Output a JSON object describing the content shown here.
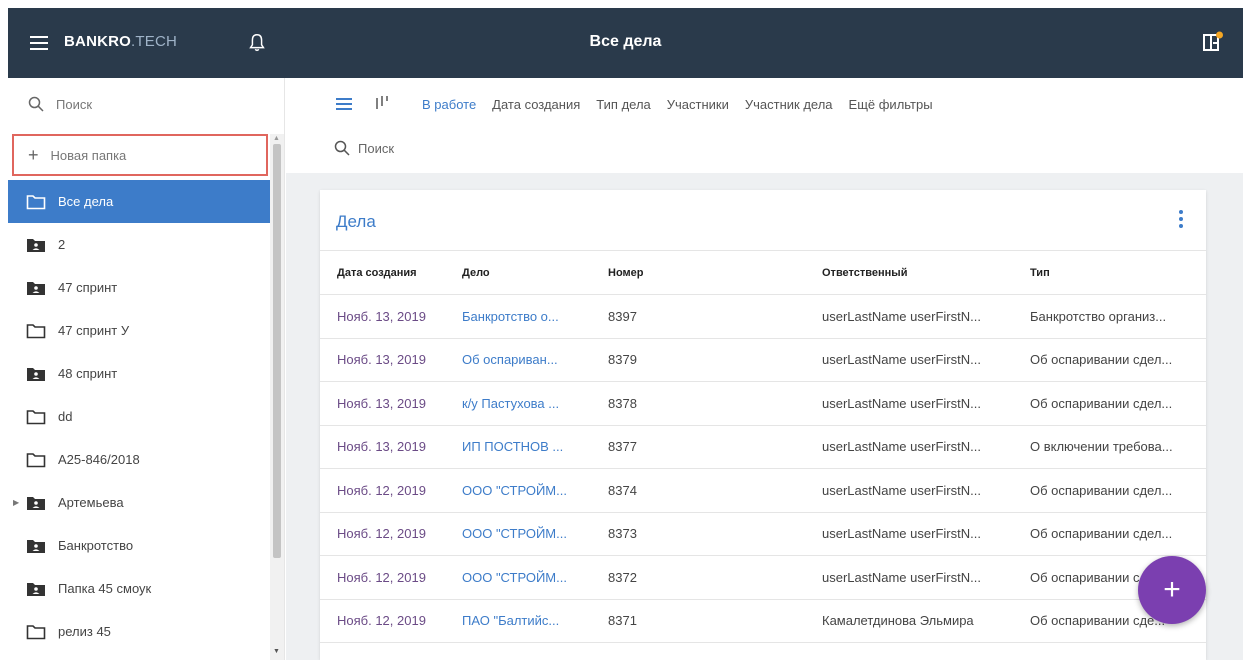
{
  "header": {
    "brand_bold": "BANKRO",
    "brand_rest": ".TECH",
    "title": "Все дела",
    "icons": {
      "menu": "hamburger-icon",
      "bell": "bell-icon",
      "app": "app-switch-icon"
    },
    "notification_color": "#f5a623"
  },
  "sidebar": {
    "search_placeholder": "Поиск",
    "new_folder_label": "Новая папка",
    "folders": [
      {
        "label": "Все дела",
        "type": "folder",
        "active": true
      },
      {
        "label": "2",
        "type": "shared-folder"
      },
      {
        "label": "47 спринт",
        "type": "shared-folder"
      },
      {
        "label": "47 спринт У",
        "type": "folder"
      },
      {
        "label": "48 спринт",
        "type": "shared-folder"
      },
      {
        "label": "dd",
        "type": "folder"
      },
      {
        "label": "A25-846/2018",
        "type": "folder"
      },
      {
        "label": "Артемьева",
        "type": "shared-folder",
        "expandable": true
      },
      {
        "label": "Банкротство",
        "type": "shared-folder"
      },
      {
        "label": "Папка 45 смоук",
        "type": "shared-folder"
      },
      {
        "label": "релиз 45",
        "type": "folder"
      }
    ]
  },
  "filters": {
    "items": [
      "В работе",
      "Дата создания",
      "Тип дела",
      "Участники",
      "Участник дела",
      "Ещё фильтры"
    ],
    "active_index": 0,
    "search_placeholder": "Поиск"
  },
  "table": {
    "title": "Дела",
    "columns": [
      "Дата создания",
      "Дело",
      "Номер",
      "Ответственный",
      "Тип"
    ],
    "rows": [
      [
        "Нояб. 13, 2019",
        "Банкротство о...",
        "8397",
        "userLastName userFirstN...",
        "Банкротство организ..."
      ],
      [
        "Нояб. 13, 2019",
        "Об оспариван...",
        "8379",
        "userLastName userFirstN...",
        "Об оспаривании сдел..."
      ],
      [
        "Нояб. 13, 2019",
        "к/у Пастухова ...",
        "8378",
        "userLastName userFirstN...",
        "Об оспаривании сдел..."
      ],
      [
        "Нояб. 13, 2019",
        "ИП ПОСТНОВ ...",
        "8377",
        "userLastName userFirstN...",
        "О включении требова..."
      ],
      [
        "Нояб. 12, 2019",
        "ООО \"СТРОЙМ...",
        "8374",
        "userLastName userFirstN...",
        "Об оспаривании сдел..."
      ],
      [
        "Нояб. 12, 2019",
        "ООО \"СТРОЙМ...",
        "8373",
        "userLastName userFirstN...",
        "Об оспаривании сдел..."
      ],
      [
        "Нояб. 12, 2019",
        "ООО \"СТРОЙМ...",
        "8372",
        "userLastName userFirstN...",
        "Об оспаривании сд..."
      ],
      [
        "Нояб. 12, 2019",
        "ПАО \"Балтийс...",
        "8371",
        "Камалетдинова Эльмира",
        "Об оспаривании сде..."
      ]
    ]
  },
  "fab": {
    "label": "+"
  },
  "colors": {
    "topbar": "#2a3a4b",
    "accent": "#3d7cc9",
    "fab": "#7b3fb0",
    "date": "#6b4b86",
    "highlight_border": "#e0665e"
  }
}
